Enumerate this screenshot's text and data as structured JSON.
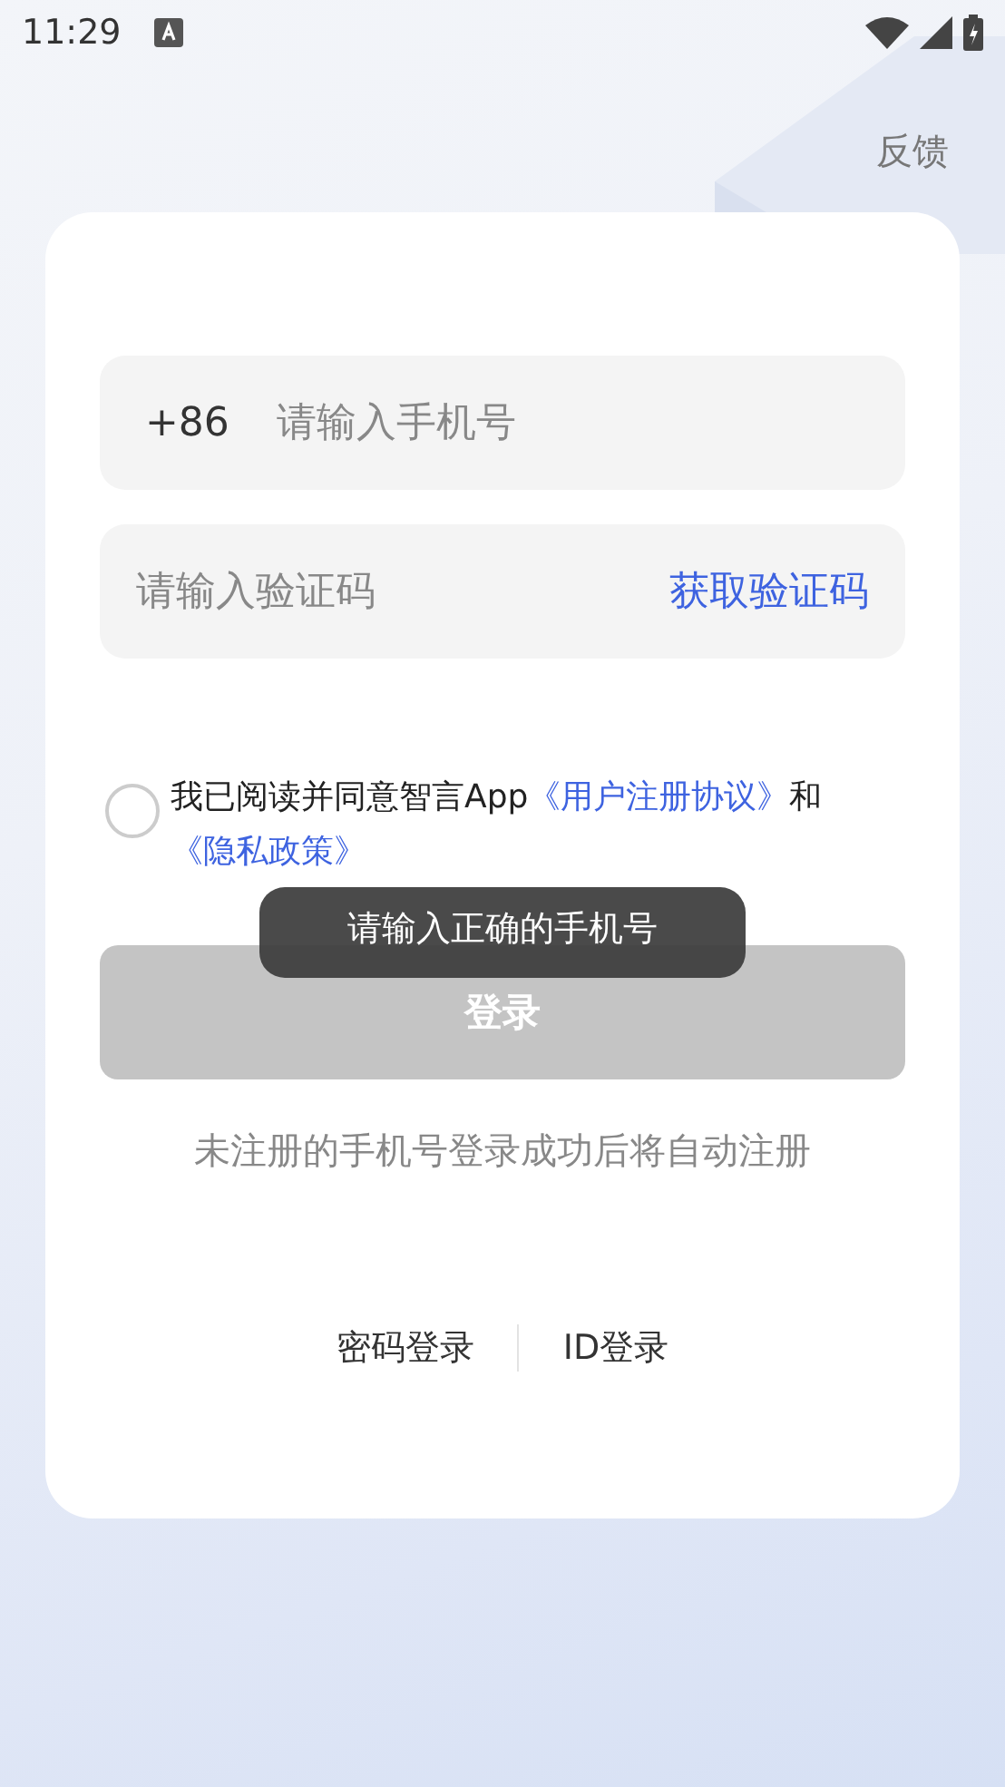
{
  "status_bar": {
    "time": "11:29"
  },
  "feedback": "反馈",
  "phone_field": {
    "prefix": "+86",
    "placeholder": "请输入手机号"
  },
  "code_field": {
    "placeholder": "请输入验证码",
    "action": "获取验证码"
  },
  "agreement": {
    "checked": false,
    "parts": [
      {
        "kind": "text",
        "text": "我已阅读并同意智言App"
      },
      {
        "kind": "link",
        "text": "《用户注册协议》"
      },
      {
        "kind": "text",
        "text": "和"
      },
      {
        "kind": "link",
        "text": "《隐私政策》"
      }
    ]
  },
  "login_button": {
    "label": "登录",
    "disabled": true
  },
  "hint": "未注册的手机号登录成功后将自动注册",
  "alt_logins": [
    "密码登录",
    "ID登录"
  ],
  "toast": "请输入正确的手机号"
}
